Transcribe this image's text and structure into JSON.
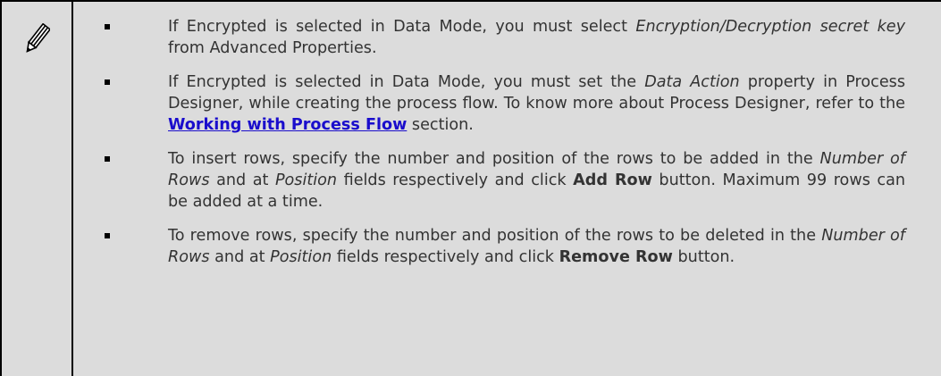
{
  "note": {
    "icon": "pencil-icon",
    "items": [
      {
        "t1": "If Encrypted is selected in Data Mode, you must select ",
        "i1": "Encryption/Decryption secret key",
        "t2": " from Advanced Properties."
      },
      {
        "t1": "If Encrypted is selected in Data Mode, you must set the ",
        "i1": "Data Action",
        "t2": " property in Process Designer, while creating the process flow. To know more about Process Designer, refer to the ",
        "link": "Working with Process Flow",
        "t3": " section."
      },
      {
        "t1": "To insert rows, specify the number and position of the rows to be added in the ",
        "i1": "Number of Rows",
        "t2": " and at ",
        "i2": "Position",
        "t3": " fields respectively and click ",
        "b1": "Add Row",
        "t4": " button. Maximum 99 rows can be added at a time."
      },
      {
        "t1": "To remove rows, specify the number and position of the rows to be deleted in the ",
        "i1": "Number of Rows",
        "t2": " and at ",
        "i2": "Position",
        "t3": " fields respectively and click ",
        "b1": "Remove Row",
        "t4": " button."
      }
    ]
  }
}
